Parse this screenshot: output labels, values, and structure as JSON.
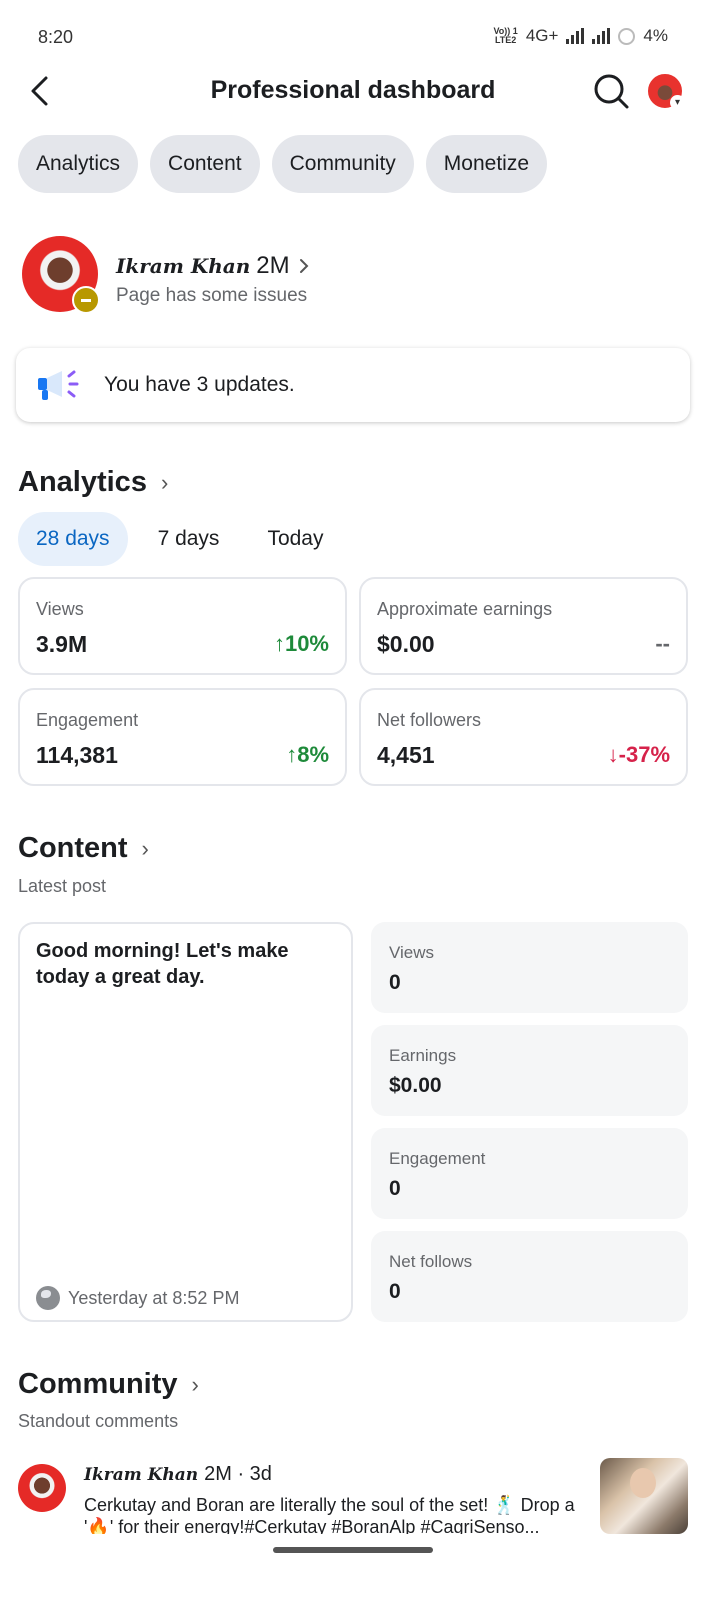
{
  "status_bar": {
    "time": "8:20",
    "volte_top": "Vo)) 1",
    "volte_bottom": "LTE2",
    "network": "4G+",
    "battery": "4%"
  },
  "header": {
    "title": "Professional dashboard"
  },
  "tabs": [
    {
      "label": "Analytics"
    },
    {
      "label": "Content"
    },
    {
      "label": "Community"
    },
    {
      "label": "Monetize"
    }
  ],
  "profile": {
    "name": "Ikram Khan",
    "follower_suffix": "2M",
    "status": "Page has some issues"
  },
  "updates": {
    "text": "You have 3 updates."
  },
  "analytics": {
    "title": "Analytics",
    "ranges": [
      {
        "label": "28 days",
        "active": true
      },
      {
        "label": "7 days",
        "active": false
      },
      {
        "label": "Today",
        "active": false
      }
    ],
    "metrics": [
      {
        "label": "Views",
        "value": "3.9M",
        "delta": "10%",
        "direction": "up"
      },
      {
        "label": "Approximate earnings",
        "value": "$0.00",
        "delta": "--",
        "direction": "none"
      },
      {
        "label": "Engagement",
        "value": "114,381",
        "delta": "8%",
        "direction": "up"
      },
      {
        "label": "Net followers",
        "value": "4,451",
        "delta": "-37%",
        "direction": "down"
      }
    ]
  },
  "content": {
    "title": "Content",
    "subtitle": "Latest post",
    "post_text": "Good morning! Let's make today a great day.",
    "post_time": "Yesterday at 8:52 PM",
    "stats": [
      {
        "label": "Views",
        "value": "0"
      },
      {
        "label": "Earnings",
        "value": "$0.00"
      },
      {
        "label": "Engagement",
        "value": "0"
      },
      {
        "label": "Net follows",
        "value": "0"
      }
    ]
  },
  "community": {
    "title": "Community",
    "subtitle": "Standout comments",
    "comment": {
      "author": "Ikram Khan",
      "suffix": "2M · 3d",
      "text": "Cerkutay and Boran are literally the soul of the set! 🕺 Drop a '🔥' for their energy!#Cerkutay #BoranAlp #CagriSenso..."
    }
  },
  "colors": {
    "accent": "#0a66c2",
    "up": "#1e8a3a",
    "down": "#d6224a",
    "chip_bg": "#e4e6eb"
  }
}
